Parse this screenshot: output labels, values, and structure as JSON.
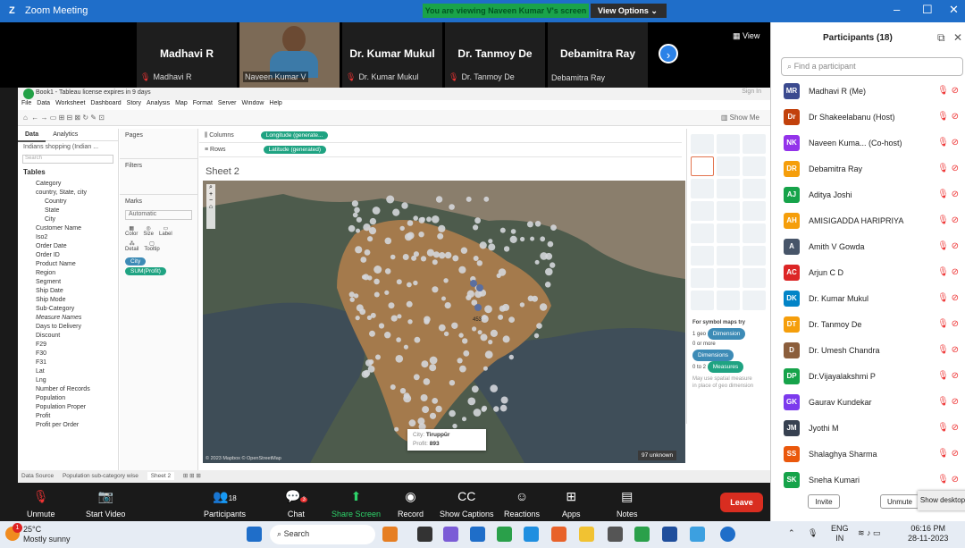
{
  "window": {
    "title": "Zoom Meeting",
    "logo": "Z",
    "controls": [
      "–",
      "☐",
      "✕"
    ]
  },
  "banner": {
    "text": "You are viewing Naveen Kumar V's screen",
    "view_options": "View Options"
  },
  "gallery": {
    "view_label": "View",
    "tiles": [
      {
        "name": "Madhavi R",
        "sub": "Madhavi R",
        "muted": true
      },
      {
        "name": "",
        "sub": "Naveen Kumar V",
        "muted": false,
        "video": true
      },
      {
        "name": "Dr. Kumar Mukul",
        "sub": "Dr. Kumar Mukul",
        "muted": true
      },
      {
        "name": "Dr. Tanmoy De",
        "sub": "Dr. Tanmoy De",
        "muted": true
      },
      {
        "name": "Debamitra Ray",
        "sub": "Debamitra Ray",
        "muted": false
      }
    ]
  },
  "tableau": {
    "title": "Book1 - Tableau license expires in 9 days",
    "sign_in": "Sign In",
    "menu": [
      "File",
      "Data",
      "Worksheet",
      "Dashboard",
      "Story",
      "Analysis",
      "Map",
      "Format",
      "Server",
      "Window",
      "Help"
    ],
    "show_me_label": "Show Me",
    "data_tabs": [
      "Data",
      "Analytics"
    ],
    "datasource": "Indians shopping (Indian ...",
    "search_placeholder": "Search",
    "tables_header": "Tables",
    "fields": [
      {
        "label": "Category",
        "indent": false
      },
      {
        "label": "country, State, city",
        "indent": false
      },
      {
        "label": "Country",
        "indent": true
      },
      {
        "label": "State",
        "indent": true
      },
      {
        "label": "City",
        "indent": true
      },
      {
        "label": "Customer Name",
        "indent": false
      },
      {
        "label": "Iso2",
        "indent": false
      },
      {
        "label": "Order Date",
        "indent": false
      },
      {
        "label": "Order ID",
        "indent": false
      },
      {
        "label": "Product Name",
        "indent": false
      },
      {
        "label": "Region",
        "indent": false
      },
      {
        "label": "Segment",
        "indent": false
      },
      {
        "label": "Ship Date",
        "indent": false
      },
      {
        "label": "Ship Mode",
        "indent": false
      },
      {
        "label": "Sub-Category",
        "indent": false
      },
      {
        "label": "Measure Names",
        "indent": false,
        "italic": true
      },
      {
        "label": "Days to Delivery",
        "indent": false
      },
      {
        "label": "Discount",
        "indent": false
      },
      {
        "label": "F29",
        "indent": false
      },
      {
        "label": "F30",
        "indent": false
      },
      {
        "label": "F31",
        "indent": false
      },
      {
        "label": "Lat",
        "indent": false
      },
      {
        "label": "Lng",
        "indent": false
      },
      {
        "label": "Number of Records",
        "indent": false
      },
      {
        "label": "Population",
        "indent": false
      },
      {
        "label": "Population Proper",
        "indent": false
      },
      {
        "label": "Profit",
        "indent": false
      },
      {
        "label": "Profit per Order",
        "indent": false
      }
    ],
    "pages": "Pages",
    "filters": "Filters",
    "marks": "Marks",
    "marks_type": "Automatic",
    "marks_cards": [
      "Color",
      "Size",
      "Label",
      "Detail",
      "Tooltip"
    ],
    "marks_pills": [
      "City",
      "SUM(Profit)"
    ],
    "columns_label": "Columns",
    "rows_label": "Rows",
    "columns_pill": "Longitude (generate...",
    "rows_pill": "Latitude (generated)",
    "sheet_title": "Sheet 2",
    "tooltip": {
      "city_label": "City:",
      "city_value": "Tiruppūr",
      "profit_label": "Profit:",
      "profit_value": "893"
    },
    "map_label": "453",
    "attribution": "© 2023 Mapbox © OpenStreetMap",
    "unknown_badge": "97 unknown",
    "showme_text": {
      "title": "For symbol maps try",
      "line1_pre": "1 geo",
      "line1_pill": "Dimension",
      "line2_pre": "0 or more",
      "line2_pill": "Dimensions",
      "line3_pre": "0 to 2",
      "line3_pill": "Measures",
      "note": "May use spatial measure in place of geo dimension"
    },
    "tabs": [
      "Data Source",
      "Population sub-category wise",
      "Sheet 2"
    ]
  },
  "toolbar": {
    "buttons": [
      {
        "label": "Unmute",
        "icon": "mic-muted-icon"
      },
      {
        "label": "Start Video",
        "icon": "video-off-icon"
      },
      {
        "label": "Participants",
        "icon": "participants-icon",
        "count": "18"
      },
      {
        "label": "Chat",
        "icon": "chat-icon",
        "badge": "3"
      },
      {
        "label": "Share Screen",
        "icon": "share-screen-icon"
      },
      {
        "label": "Record",
        "icon": "record-icon"
      },
      {
        "label": "Show Captions",
        "icon": "captions-icon"
      },
      {
        "label": "Reactions",
        "icon": "reactions-icon"
      },
      {
        "label": "Apps",
        "icon": "apps-icon"
      },
      {
        "label": "Notes",
        "icon": "notes-icon"
      }
    ],
    "leave": "Leave"
  },
  "participants": {
    "title": "Participants (18)",
    "search_placeholder": "Find a participant",
    "list": [
      {
        "initials": "MR",
        "name": "Madhavi R (Me)",
        "color": "#3b4a8f"
      },
      {
        "initials": "Dr",
        "name": "Dr Shakeelabanu (Host)",
        "color": "#c2410c"
      },
      {
        "initials": "NK",
        "name": "Naveen Kuma... (Co-host)",
        "color": "#9333ea"
      },
      {
        "initials": "DR",
        "name": "Debamitra Ray",
        "color": "#f59e0b"
      },
      {
        "initials": "AJ",
        "name": "Aditya Joshi",
        "color": "#16a34a"
      },
      {
        "initials": "AH",
        "name": "AMISIGADDA HARIPRIYA",
        "color": "#f59e0b"
      },
      {
        "initials": "A",
        "name": "Amith V Gowda",
        "color": "#475569"
      },
      {
        "initials": "AC",
        "name": "Arjun C D",
        "color": "#dc2626"
      },
      {
        "initials": "DK",
        "name": "Dr. Kumar Mukul",
        "color": "#0284c7"
      },
      {
        "initials": "DT",
        "name": "Dr. Tanmoy De",
        "color": "#f59e0b"
      },
      {
        "initials": "D",
        "name": "Dr. Umesh Chandra",
        "color": "#8b5e3c"
      },
      {
        "initials": "DP",
        "name": "Dr.Vijayalakshmi P",
        "color": "#16a34a"
      },
      {
        "initials": "GK",
        "name": "Gaurav Kundekar",
        "color": "#7c3aed"
      },
      {
        "initials": "JM",
        "name": "Jyothi M",
        "color": "#374151"
      },
      {
        "initials": "SS",
        "name": "Shalaghya Sharma",
        "color": "#ea580c"
      },
      {
        "initials": "SK",
        "name": "Sneha Kumari",
        "color": "#16a34a"
      }
    ],
    "invite": "Invite",
    "unmute": "Unmute",
    "show_desktop": "Show desktop"
  },
  "taskbar": {
    "temp": "25°C",
    "weather": "Mostly sunny",
    "badge": "1",
    "search": "Search",
    "lang1": "ENG",
    "lang2": "IN",
    "time": "06:16 PM",
    "date": "28-11-2023"
  }
}
